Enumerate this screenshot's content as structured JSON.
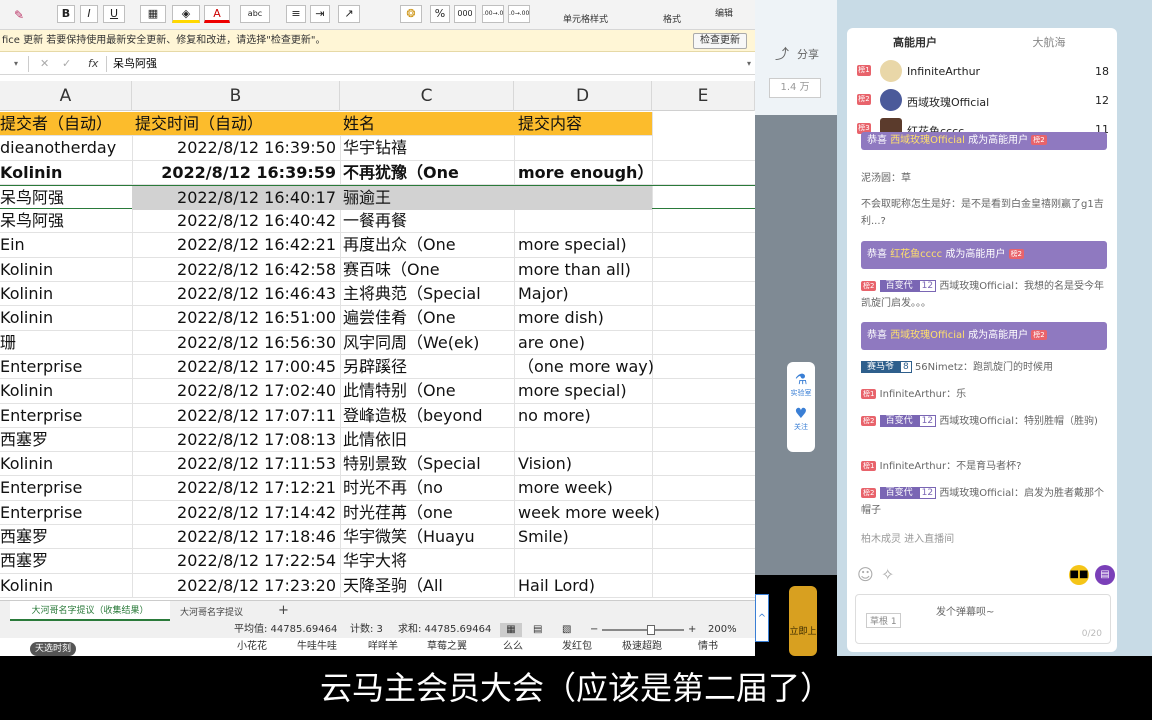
{
  "ribbon": {
    "bold": "B",
    "italic": "I",
    "underline": "U",
    "percent": "%",
    "thousands": "000",
    "dec_inc": ".00→.0",
    "dec_dec": ".0→.00",
    "cell_style": "单元格样式",
    "format": "格式",
    "edit": "编辑",
    "abc": "abc"
  },
  "notice": {
    "text": "fice 更新  若要保持使用最新安全更新、修复和改进，请选择\"检查更新\"。",
    "button": "检查更新"
  },
  "formula_bar": {
    "fx": "fx",
    "value": "呆鸟阿强"
  },
  "columns": [
    "A",
    "B",
    "C",
    "D",
    "E"
  ],
  "header": [
    "提交者（自动）",
    "提交时间（自动）",
    "姓名",
    "提交内容"
  ],
  "rows": [
    [
      "dieanotherday",
      "2022/8/12 16:39:50",
      "华宇钻禧",
      ""
    ],
    [
      "Kolinin",
      "2022/8/12 16:39:59",
      "不再犹豫（One",
      "more enough）"
    ],
    [
      "呆鸟阿强",
      "2022/8/12 16:40:17",
      "骊逾王",
      ""
    ],
    [
      "呆鸟阿强",
      "2022/8/12 16:40:42",
      "一餐再餐",
      ""
    ],
    [
      "Ein",
      "2022/8/12 16:42:21",
      "再度出众（One",
      "more special)"
    ],
    [
      "Kolinin",
      "2022/8/12 16:42:58",
      "赛百味（One",
      "more than all)"
    ],
    [
      "Kolinin",
      "2022/8/12 16:46:43",
      "主将典范（Special",
      "Major)"
    ],
    [
      "Kolinin",
      "2022/8/12 16:51:00",
      "遍尝佳肴（One",
      "more dish)"
    ],
    [
      "珊",
      "2022/8/12 16:56:30",
      "风宇同周（We(ek)",
      "are one)"
    ],
    [
      "Enterprise",
      "2022/8/12 17:00:45",
      "另辟蹊径",
      "（one more way)"
    ],
    [
      "Kolinin",
      "2022/8/12 17:02:40",
      "此情特别（One",
      "more special)"
    ],
    [
      "Enterprise",
      "2022/8/12 17:07:11",
      "登峰造极（beyond",
      "no more)"
    ],
    [
      "西塞罗",
      "2022/8/12 17:08:13",
      "此情依旧",
      ""
    ],
    [
      "Kolinin",
      "2022/8/12 17:11:53",
      "特别景致（Special",
      "Vision)"
    ],
    [
      "Enterprise",
      "2022/8/12 17:12:21",
      "时光不再（no",
      "more week)"
    ],
    [
      "Enterprise",
      "2022/8/12 17:14:42",
      "时光荏苒（one",
      "week more week)"
    ],
    [
      "西塞罗",
      "2022/8/12 17:18:46",
      "华宇微笑（Huayu",
      "Smile)"
    ],
    [
      "西塞罗",
      "2022/8/12 17:22:54",
      "华宇大将",
      ""
    ],
    [
      "Kolinin",
      "2022/8/12 17:23:20",
      "天降圣驹（All",
      "Hail Lord)"
    ]
  ],
  "sheet_tabs": [
    "大河哥名字提议（收集结果）",
    "大河哥名字提议"
  ],
  "add_sheet": "+",
  "status": {
    "avg": "平均值: 44785.69464",
    "count": "计数: 3",
    "sum": "求和: 44785.69464",
    "zoom": "200%",
    "minus": "−",
    "plus": "+"
  },
  "taskbar": {
    "tag": "天选时刻",
    "items": [
      "小花花",
      "牛哇牛哇",
      "咩咩羊",
      "草莓之翼",
      "么么",
      "发红包",
      "极速超跑",
      "情书"
    ]
  },
  "mid": {
    "share": "分享",
    "count": "1.4 万",
    "lab": "实验室",
    "follow": "关注",
    "lite": "立即上"
  },
  "chat": {
    "tabs": [
      "高能用户",
      "大航海"
    ],
    "ranks": [
      {
        "medal": "榜1",
        "name": "InfiniteArthur",
        "count": "18"
      },
      {
        "medal": "榜2",
        "name": "西域玫瑰Official",
        "count": "12"
      },
      {
        "medal": "榜3",
        "name": "红花鱼cccc",
        "count": "11"
      }
    ],
    "banner1_pre": "恭喜",
    "banner1_name": "西域玫瑰Official",
    "banner1_post": "成为高能用户",
    "banner1_tag": "榜2",
    "m1": "泥汤圆：草",
    "m2": "不会取昵称怎生是好：是不是看到白金皇禧刚赢了g1吉利...?",
    "banner2_pre": "恭喜",
    "banner2_name": "红花鱼cccc",
    "banner2_post": "成为高能用户",
    "banner2_tag": "榜2",
    "m3_tag": "榜2",
    "m3_badge": "百变代",
    "m3_level": "12",
    "m3_text": "西域玫瑰Official：我想的名是受今年凯旋门启发。。。",
    "banner3_pre": "恭喜",
    "banner3_name": "西域玫瑰Official",
    "banner3_post": "成为高能用户",
    "banner3_tag": "榜2",
    "m4_badge": "赛马爷",
    "m4_level": "8",
    "m4_text": "56Nimetz：跑凯旋门的时候用",
    "m5_tag": "榜1",
    "m5_text": "InfiniteArthur：乐",
    "m6_tag": "榜2",
    "m6_badge": "百变代",
    "m6_level": "12",
    "m6_text": "西域玫瑰Official：特别胜帽（胜驹)",
    "m7_tag": "榜1",
    "m7_text": "InfiniteArthur：不是育马者杯?",
    "m8_tag": "榜2",
    "m8_badge": "百变代",
    "m8_level": "12",
    "m8_text": "西域玫瑰Official：启发为胜者戴那个帽子",
    "m9": "柏木成灵 进入直播间",
    "input_tag": "草根",
    "input_level": "1",
    "input_placeholder": "发个弹幕呗~",
    "input_counter": "0/20"
  },
  "subtitle": "云马主会员大会（应该是第二届了）"
}
